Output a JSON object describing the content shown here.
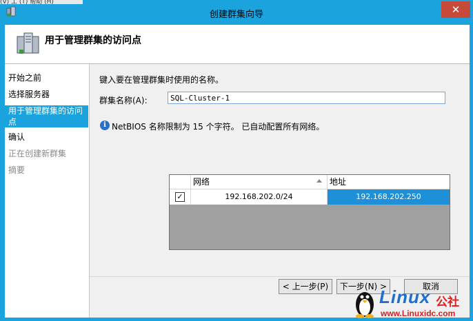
{
  "window": {
    "top_strip": "(V) 工 (T) 帮助 (H)",
    "title": "创建群集向导",
    "close_glyph": "✕"
  },
  "header": {
    "title": "用于管理群集的访问点"
  },
  "sidebar": {
    "items": [
      {
        "label": "开始之前",
        "state": "normal"
      },
      {
        "label": "选择服务器",
        "state": "normal"
      },
      {
        "label": "用于管理群集的访问点",
        "state": "active"
      },
      {
        "label": "确认",
        "state": "normal"
      },
      {
        "label": "正在创建新群集",
        "state": "disabled"
      },
      {
        "label": "摘要",
        "state": "disabled"
      }
    ]
  },
  "main": {
    "prompt": "键入要在管理群集时使用的名称。",
    "cluster_name_label": "群集名称(A):",
    "cluster_name_value": "SQL-Cluster-1",
    "info_text": "NetBIOS 名称限制为 15 个字符。 已自动配置所有网络。",
    "grid": {
      "columns": [
        "网络",
        "地址"
      ],
      "rows": [
        {
          "checked": true,
          "network": "192.168.202.0/24",
          "address": "192.168.202.250"
        }
      ]
    }
  },
  "buttons": {
    "back": "< 上一步(P)",
    "next": "下一步(N) >",
    "cancel": "取消"
  },
  "watermark": {
    "brand": "Linux",
    "brand_suffix": "公社",
    "url": "www.Linuxidc.com"
  },
  "colors": {
    "accent": "#1aa3dc",
    "close": "#c7493a",
    "selection": "#1e90d8"
  }
}
